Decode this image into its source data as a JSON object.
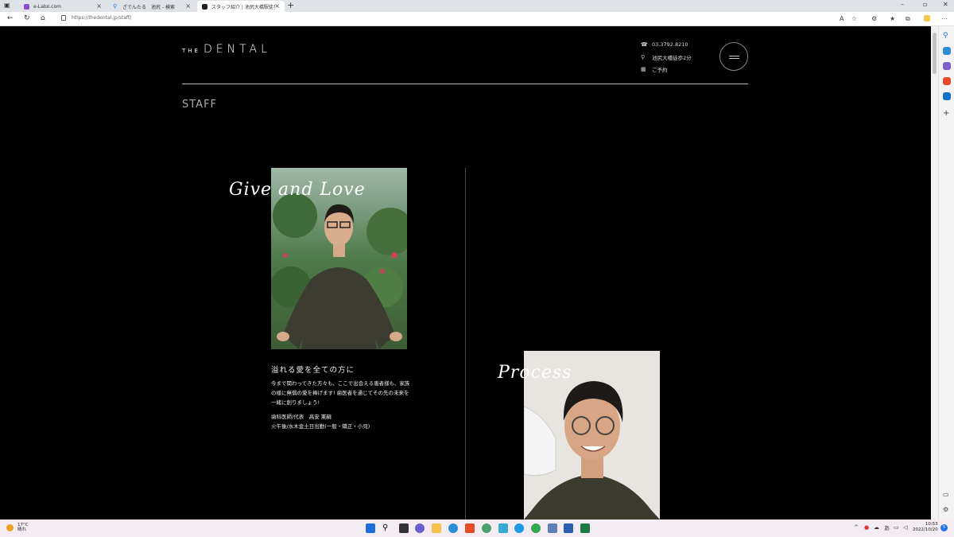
{
  "browser": {
    "tabs": [
      {
        "title": "e-Labo.com"
      },
      {
        "title": "ざでんたる　池尻 - 検索"
      },
      {
        "title": "スタッフ紹介 | 池尻大橋駅徒歩2分"
      }
    ],
    "url": "https://thedental.jp/staff/"
  },
  "site": {
    "logo_prefix": "THE",
    "logo_main": "DENTAL",
    "contact": {
      "phone": "03.3792.8210",
      "access": "池尻大橋徒歩2分",
      "reserve": "ご予約"
    },
    "section_title": "STAFF"
  },
  "staff": [
    {
      "tagline": "Give and Love",
      "heading": "溢れる愛を全ての方に",
      "message": "今まで関わってきた方々も、ここで出会える患者様も、家族の様に無償の愛を捧げます! 歯医者を通じてその先の未来を一緒に創りましょう!",
      "role_name": "歯科医師/代表　高安 憲嗣",
      "schedule": "火午後/水木金土日出勤(一般・矯正・小児)"
    },
    {
      "tagline": "Process"
    }
  ],
  "taskbar": {
    "weather_temp": "17°C",
    "weather_desc": "晴れ",
    "time": "10:53",
    "date": "2022/10/20",
    "ime": "あ",
    "notifications": "5"
  },
  "colors": {
    "page_bg": "#000000",
    "accent_orange": "#f0a020"
  }
}
